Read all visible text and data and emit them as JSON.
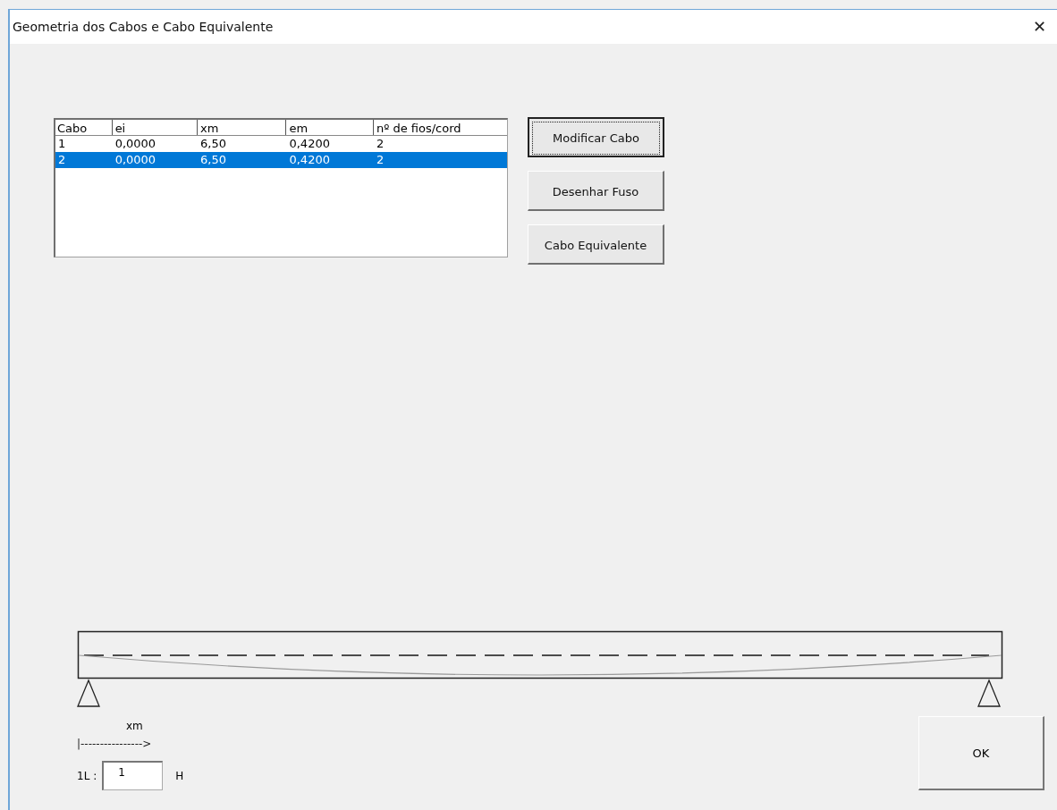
{
  "window": {
    "title": "Geometria dos Cabos e Cabo Equivalente",
    "close": "✕"
  },
  "table": {
    "columns": [
      "Cabo",
      "ei",
      "xm",
      "em",
      "nº de fios/cord"
    ],
    "rows": [
      {
        "cells": [
          "1",
          "0,0000",
          "6,50",
          "0,4200",
          "2"
        ],
        "selected": false
      },
      {
        "cells": [
          "2",
          "0,0000",
          "6,50",
          "0,4200",
          "2"
        ],
        "selected": true
      }
    ]
  },
  "buttons": [
    {
      "label": "Modificar Cabo",
      "focused": true
    },
    {
      "label": "Desenhar Fuso",
      "focused": false
    },
    {
      "label": "Cabo Equivalente",
      "focused": false
    }
  ],
  "xm_label": "xm",
  "xm_arrow": "|---------------->",
  "length": {
    "label": "1L :",
    "value": "1",
    "unit": "H"
  },
  "ok_button": "OK"
}
